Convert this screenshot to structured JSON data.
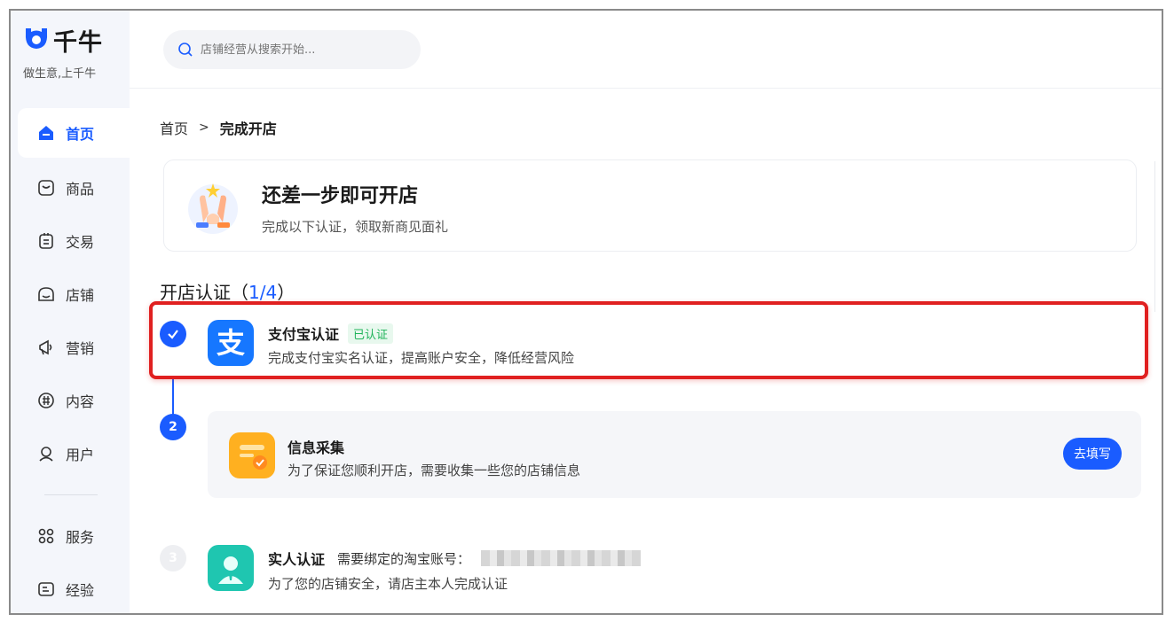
{
  "brand": {
    "name": "千牛",
    "slogan": "做生意,上千牛"
  },
  "search": {
    "placeholder": "店铺经营从搜索开始..."
  },
  "sidebar": {
    "items": [
      {
        "label": "首页",
        "icon": "home-icon",
        "active": true
      },
      {
        "label": "商品",
        "icon": "goods-icon"
      },
      {
        "label": "交易",
        "icon": "trade-icon"
      },
      {
        "label": "店铺",
        "icon": "shop-icon"
      },
      {
        "label": "营销",
        "icon": "marketing-icon"
      },
      {
        "label": "内容",
        "icon": "content-icon"
      },
      {
        "label": "用户",
        "icon": "user-icon"
      },
      {
        "label": "服务",
        "icon": "service-icon"
      },
      {
        "label": "经验",
        "icon": "experience-icon"
      }
    ]
  },
  "breadcrumb": {
    "home": "首页",
    "separator": ">",
    "current": "完成开店"
  },
  "banner": {
    "title": "还差一步即可开店",
    "subtitle": "完成以下认证，领取新商见面礼"
  },
  "section": {
    "title_prefix": "开店认证（",
    "count": "1/4",
    "title_suffix": "）"
  },
  "steps": [
    {
      "number": "",
      "title": "支付宝认证",
      "badge": "已认证",
      "desc": "完成支付宝实名认证，提高账户安全，降低经营风险",
      "icon": "alipay-icon",
      "status": "done"
    },
    {
      "number": "2",
      "title": "信息采集",
      "desc": "为了保证您顺利开店，需要收集一些您的店铺信息",
      "icon": "form-icon",
      "action": "去填写",
      "status": "current"
    },
    {
      "number": "3",
      "title": "实人认证",
      "note": "需要绑定的淘宝账号：",
      "desc": "为了您的店铺安全，请店主本人完成认证",
      "icon": "face-verify-icon",
      "status": "pending"
    }
  ],
  "colors": {
    "accent": "#1a5cff",
    "success": "#1fb35a",
    "highlight": "#e02020"
  }
}
